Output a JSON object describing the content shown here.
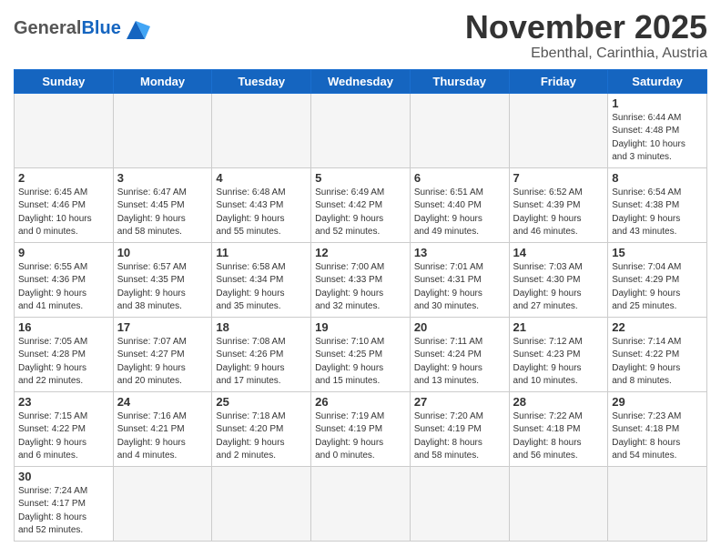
{
  "logo": {
    "general": "General",
    "blue": "Blue"
  },
  "header": {
    "month": "November 2025",
    "location": "Ebenthal, Carinthia, Austria"
  },
  "weekdays": [
    "Sunday",
    "Monday",
    "Tuesday",
    "Wednesday",
    "Thursday",
    "Friday",
    "Saturday"
  ],
  "weeks": [
    [
      {
        "day": "",
        "info": ""
      },
      {
        "day": "",
        "info": ""
      },
      {
        "day": "",
        "info": ""
      },
      {
        "day": "",
        "info": ""
      },
      {
        "day": "",
        "info": ""
      },
      {
        "day": "",
        "info": ""
      },
      {
        "day": "1",
        "info": "Sunrise: 6:44 AM\nSunset: 4:48 PM\nDaylight: 10 hours\nand 3 minutes."
      }
    ],
    [
      {
        "day": "2",
        "info": "Sunrise: 6:45 AM\nSunset: 4:46 PM\nDaylight: 10 hours\nand 0 minutes."
      },
      {
        "day": "3",
        "info": "Sunrise: 6:47 AM\nSunset: 4:45 PM\nDaylight: 9 hours\nand 58 minutes."
      },
      {
        "day": "4",
        "info": "Sunrise: 6:48 AM\nSunset: 4:43 PM\nDaylight: 9 hours\nand 55 minutes."
      },
      {
        "day": "5",
        "info": "Sunrise: 6:49 AM\nSunset: 4:42 PM\nDaylight: 9 hours\nand 52 minutes."
      },
      {
        "day": "6",
        "info": "Sunrise: 6:51 AM\nSunset: 4:40 PM\nDaylight: 9 hours\nand 49 minutes."
      },
      {
        "day": "7",
        "info": "Sunrise: 6:52 AM\nSunset: 4:39 PM\nDaylight: 9 hours\nand 46 minutes."
      },
      {
        "day": "8",
        "info": "Sunrise: 6:54 AM\nSunset: 4:38 PM\nDaylight: 9 hours\nand 43 minutes."
      }
    ],
    [
      {
        "day": "9",
        "info": "Sunrise: 6:55 AM\nSunset: 4:36 PM\nDaylight: 9 hours\nand 41 minutes."
      },
      {
        "day": "10",
        "info": "Sunrise: 6:57 AM\nSunset: 4:35 PM\nDaylight: 9 hours\nand 38 minutes."
      },
      {
        "day": "11",
        "info": "Sunrise: 6:58 AM\nSunset: 4:34 PM\nDaylight: 9 hours\nand 35 minutes."
      },
      {
        "day": "12",
        "info": "Sunrise: 7:00 AM\nSunset: 4:33 PM\nDaylight: 9 hours\nand 32 minutes."
      },
      {
        "day": "13",
        "info": "Sunrise: 7:01 AM\nSunset: 4:31 PM\nDaylight: 9 hours\nand 30 minutes."
      },
      {
        "day": "14",
        "info": "Sunrise: 7:03 AM\nSunset: 4:30 PM\nDaylight: 9 hours\nand 27 minutes."
      },
      {
        "day": "15",
        "info": "Sunrise: 7:04 AM\nSunset: 4:29 PM\nDaylight: 9 hours\nand 25 minutes."
      }
    ],
    [
      {
        "day": "16",
        "info": "Sunrise: 7:05 AM\nSunset: 4:28 PM\nDaylight: 9 hours\nand 22 minutes."
      },
      {
        "day": "17",
        "info": "Sunrise: 7:07 AM\nSunset: 4:27 PM\nDaylight: 9 hours\nand 20 minutes."
      },
      {
        "day": "18",
        "info": "Sunrise: 7:08 AM\nSunset: 4:26 PM\nDaylight: 9 hours\nand 17 minutes."
      },
      {
        "day": "19",
        "info": "Sunrise: 7:10 AM\nSunset: 4:25 PM\nDaylight: 9 hours\nand 15 minutes."
      },
      {
        "day": "20",
        "info": "Sunrise: 7:11 AM\nSunset: 4:24 PM\nDaylight: 9 hours\nand 13 minutes."
      },
      {
        "day": "21",
        "info": "Sunrise: 7:12 AM\nSunset: 4:23 PM\nDaylight: 9 hours\nand 10 minutes."
      },
      {
        "day": "22",
        "info": "Sunrise: 7:14 AM\nSunset: 4:22 PM\nDaylight: 9 hours\nand 8 minutes."
      }
    ],
    [
      {
        "day": "23",
        "info": "Sunrise: 7:15 AM\nSunset: 4:22 PM\nDaylight: 9 hours\nand 6 minutes."
      },
      {
        "day": "24",
        "info": "Sunrise: 7:16 AM\nSunset: 4:21 PM\nDaylight: 9 hours\nand 4 minutes."
      },
      {
        "day": "25",
        "info": "Sunrise: 7:18 AM\nSunset: 4:20 PM\nDaylight: 9 hours\nand 2 minutes."
      },
      {
        "day": "26",
        "info": "Sunrise: 7:19 AM\nSunset: 4:19 PM\nDaylight: 9 hours\nand 0 minutes."
      },
      {
        "day": "27",
        "info": "Sunrise: 7:20 AM\nSunset: 4:19 PM\nDaylight: 8 hours\nand 58 minutes."
      },
      {
        "day": "28",
        "info": "Sunrise: 7:22 AM\nSunset: 4:18 PM\nDaylight: 8 hours\nand 56 minutes."
      },
      {
        "day": "29",
        "info": "Sunrise: 7:23 AM\nSunset: 4:18 PM\nDaylight: 8 hours\nand 54 minutes."
      }
    ],
    [
      {
        "day": "30",
        "info": "Sunrise: 7:24 AM\nSunset: 4:17 PM\nDaylight: 8 hours\nand 52 minutes."
      },
      {
        "day": "",
        "info": ""
      },
      {
        "day": "",
        "info": ""
      },
      {
        "day": "",
        "info": ""
      },
      {
        "day": "",
        "info": ""
      },
      {
        "day": "",
        "info": ""
      },
      {
        "day": "",
        "info": ""
      }
    ]
  ]
}
